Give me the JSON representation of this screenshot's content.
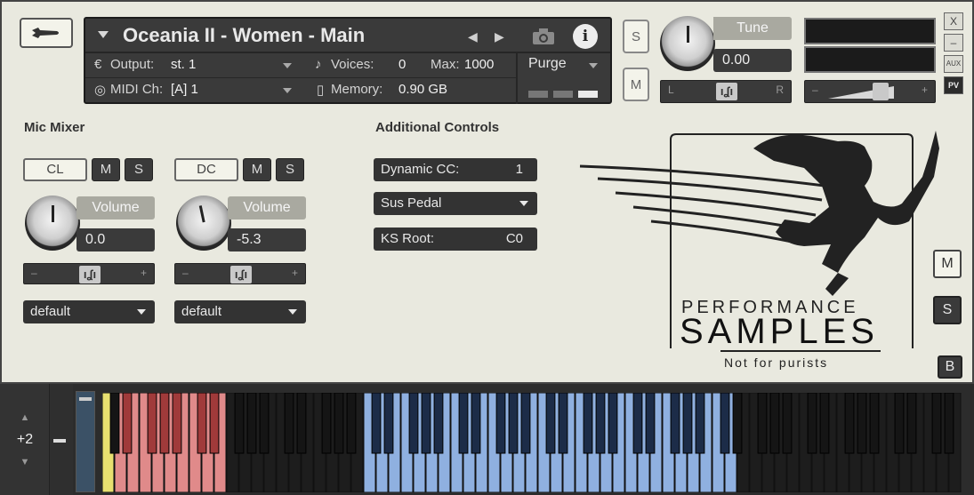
{
  "header": {
    "title": "Oceania II - Women - Main",
    "output_label": "Output:",
    "output_value": "st. 1",
    "voices_label": "Voices:",
    "voices_value": "0",
    "max_label": "Max:",
    "max_value": "1000",
    "midi_label": "MIDI Ch:",
    "midi_value": "[A]  1",
    "memory_label": "Memory:",
    "memory_value": "0.90 GB",
    "purge_label": "Purge"
  },
  "solo_mute": {
    "solo": "S",
    "mute": "M"
  },
  "tune": {
    "label": "Tune",
    "value": "0.00",
    "pan_left": "L",
    "pan_right": "R"
  },
  "window_buttons": {
    "close": "X",
    "minimize": "–",
    "aux": "AUX",
    "pv": "PV"
  },
  "mic_mixer": {
    "title": "Mic Mixer",
    "channels": [
      {
        "name": "CL",
        "mute": "M",
        "solo": "S",
        "vol_label": "Volume",
        "vol_value": "0.0",
        "route": "default"
      },
      {
        "name": "DC",
        "mute": "M",
        "solo": "S",
        "vol_label": "Volume",
        "vol_value": "-5.3",
        "route": "default"
      }
    ]
  },
  "additional_controls": {
    "title": "Additional Controls",
    "dynamic_cc_label": "Dynamic CC:",
    "dynamic_cc_value": "1",
    "sus_pedal": "Sus Pedal",
    "ks_root_label": "KS Root:",
    "ks_root_value": "C0"
  },
  "logo": {
    "line1": "PERFORMANCE",
    "line2": "SAMPLES",
    "tagline": "Not for purists"
  },
  "right_buttons": {
    "m": "M",
    "s": "S",
    "b": "B"
  },
  "keyboard": {
    "octave": "+2",
    "octave_up": "▲",
    "octave_down": "▼",
    "colors": {
      "keyswitch": "#e08a8a",
      "playable": "#8fb0e0",
      "yellow": "#e8e070"
    }
  }
}
